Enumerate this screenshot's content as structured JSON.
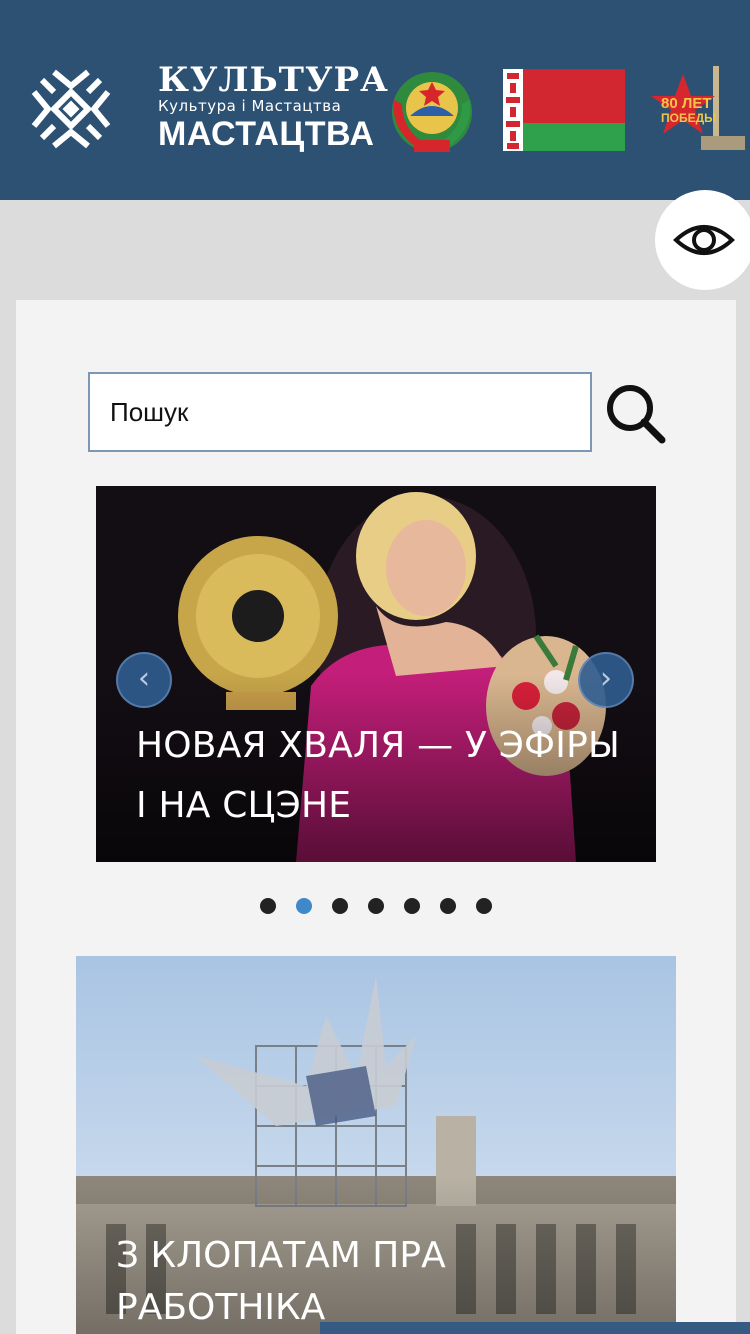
{
  "header": {
    "brand_top": "КУЛЬТУРА",
    "brand_sub": "Культура і Мастацтва",
    "brand_bottom": "МАСТАЦТВА",
    "emblem_icon": "belarus-emblem-icon",
    "flag_icon": "belarus-flag-icon",
    "victory_icon": "victory-80-icon",
    "victory_text": "80 ЛЕТ ПОБЕДЫ",
    "bg_color": "#2c5173"
  },
  "accessibility": {
    "icon": "eye-icon"
  },
  "search": {
    "placeholder": "Пошук",
    "icon": "search-icon"
  },
  "slider": {
    "title": "НОВАЯ ХВАЛЯ — У ЭФІРЫ І НА СЦЭНЕ",
    "prev_icon": "chevron-left-icon",
    "next_icon": "chevron-right-icon",
    "dots": [
      {
        "active": false
      },
      {
        "active": true
      },
      {
        "active": false
      },
      {
        "active": false
      },
      {
        "active": false
      },
      {
        "active": false
      },
      {
        "active": false
      }
    ],
    "accent_color": "#3f88c9"
  },
  "news_card": {
    "title": "З КЛОПАТАМ ПРА РАБОТНІКА"
  }
}
